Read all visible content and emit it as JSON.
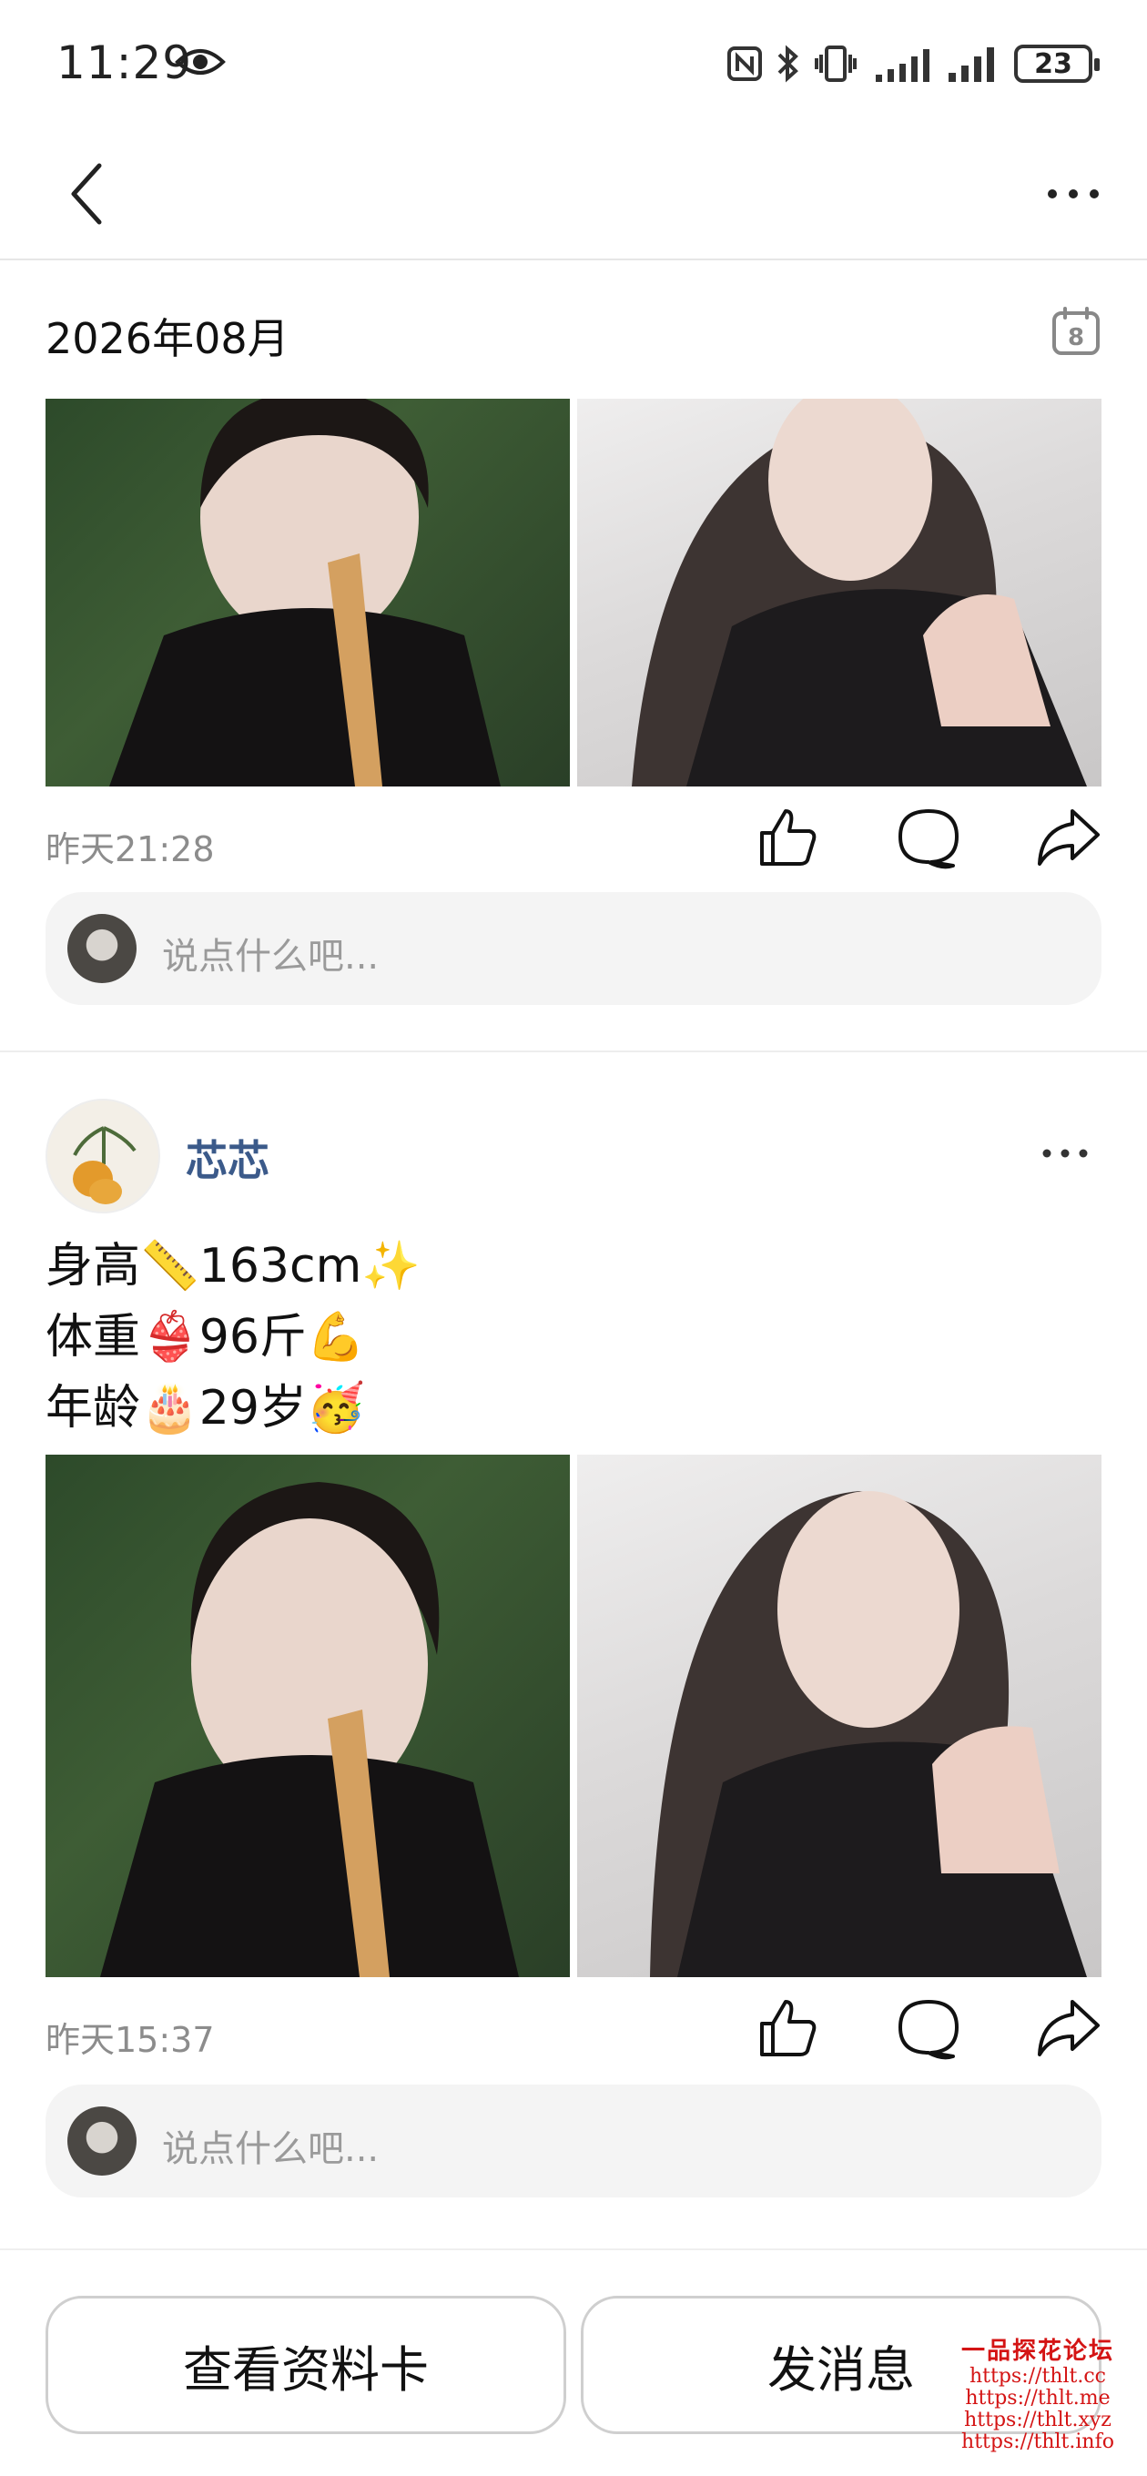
{
  "status_bar": {
    "time": "11:29",
    "battery": "23"
  },
  "nav": {
    "back_icon": "chevron-left-icon",
    "more_icon": "more-horizontal-icon"
  },
  "month": {
    "title": "2026年08月",
    "calendar_day": "8"
  },
  "posts": [
    {
      "time": "昨天21:28",
      "comment_placeholder": "说点什么吧..."
    },
    {
      "author": "芯芯",
      "text_lines": [
        "身高📏163cm✨",
        "体重👙96斤💪",
        "年龄🎂29岁🥳"
      ],
      "time": "昨天15:37",
      "comment_placeholder": "说点什么吧..."
    }
  ],
  "bottom": {
    "profile_button": "查看资料卡",
    "message_button": "发消息"
  },
  "watermark": {
    "title": "一品探花论坛",
    "lines": [
      "https://thlt.cc",
      "https://thlt.me",
      "https://thlt.xyz",
      "https://thlt.info"
    ]
  },
  "colors": {
    "author_name": "#3b5a8a",
    "watermark": "#d41414",
    "secondary_text": "#8c8c8c"
  }
}
